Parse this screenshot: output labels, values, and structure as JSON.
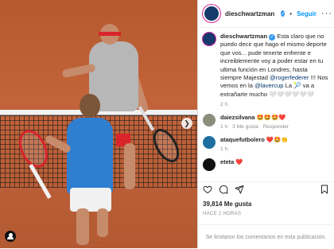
{
  "post": {
    "username": "dieschwartzman",
    "follow_label": "Seguir",
    "more_icon": "more-dots-icon",
    "caption": {
      "username": "dieschwartzman",
      "text_before": " Esta claro que no puedo decir que hago el mismo deporte que vos... pude tenerte enfrente e increiblemente voy a poder estar en tu ultima función en Londres, hasta siempre Majestad ",
      "mention_1": "@rogerfederer",
      "text_middle": " !!! Nos vemos en la ",
      "mention_2": "@lavercup",
      "text_after": " La 🎾 va a extrañarte mucho 🤍🤍🤍🤍🤍🤍",
      "time": "2 h"
    },
    "comments": [
      {
        "username": "daiezsilvana",
        "text": "🤩🤩🤩❤️",
        "time": "1 h",
        "likes": "3 Me gusta",
        "reply": "Responder"
      },
      {
        "username": "ataquefutbolero",
        "text": "❤️🤩👏",
        "time": "1 h",
        "likes": "",
        "reply": ""
      },
      {
        "username": "eteta",
        "text": "❤️",
        "time": "",
        "likes": "",
        "reply": ""
      }
    ],
    "likes_count": "39,814",
    "likes_label": "Me gusta",
    "posted_ago": "HACE 2 HORAS",
    "comments_limited": "Se limitaron los comentarios en esta publicación."
  },
  "icons": {
    "heart": "heart-icon",
    "comment": "comment-icon",
    "share": "share-icon",
    "save": "bookmark-icon",
    "next": "chevron-right-icon",
    "user_tag": "user-tag-icon"
  }
}
